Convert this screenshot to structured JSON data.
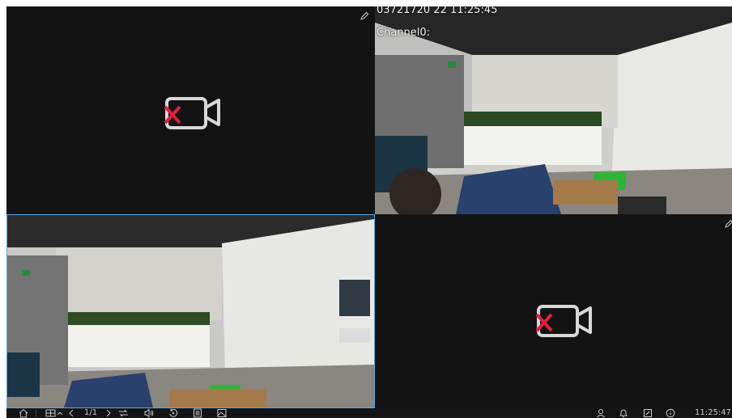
{
  "tiles": [
    {
      "id": "tile-1",
      "state": "no-video",
      "edit_icon": "pencil-icon",
      "no_video_icon": "camera-off-icon"
    },
    {
      "id": "tile-2",
      "state": "live",
      "osd_time": "03721720 22 11:25:45",
      "osd_channel": "Channel0:"
    },
    {
      "id": "tile-3",
      "state": "live",
      "selected": true
    },
    {
      "id": "tile-4",
      "state": "no-video",
      "edit_icon": "pencil-icon",
      "no_video_icon": "camera-off-icon"
    }
  ],
  "taskbar": {
    "page_indicator": "1/1",
    "clock": "11:25:47",
    "icons": [
      "home-icon",
      "split-screen-icon",
      "chevron-up-icon",
      "prev-page-icon",
      "next-page-icon",
      "sequence-icon",
      "audio-icon",
      "playback-icon",
      "list-icon",
      "image-icon",
      "user-icon",
      "alarm-bell-icon",
      "manual-record-icon",
      "info-icon"
    ]
  },
  "colors": {
    "no_video_x": "#e0203a",
    "selected_border": "#5aa8e6",
    "bar_bg": "#141414"
  }
}
